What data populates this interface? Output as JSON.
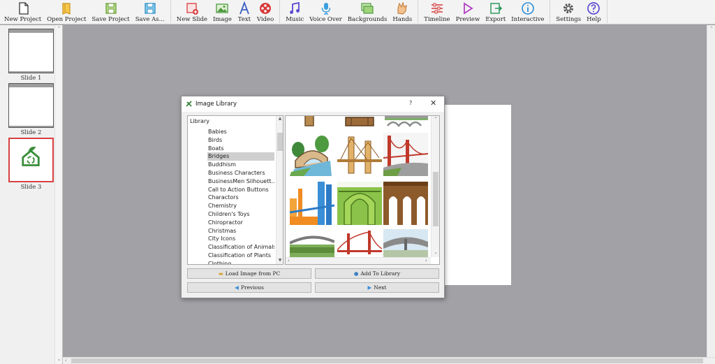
{
  "toolbar": {
    "groups": [
      [
        {
          "id": "new-project",
          "label": "New Project",
          "icon": "new-document-icon"
        },
        {
          "id": "open-project",
          "label": "Open Project",
          "icon": "open-folder-icon"
        },
        {
          "id": "save-project",
          "label": "Save Project",
          "icon": "save-icon"
        },
        {
          "id": "save-as",
          "label": "Save As...",
          "icon": "save-as-icon"
        }
      ],
      [
        {
          "id": "new-slide",
          "label": "New Slide",
          "icon": "new-slide-icon"
        },
        {
          "id": "image",
          "label": "Image",
          "icon": "image-icon"
        },
        {
          "id": "text",
          "label": "Text",
          "icon": "text-icon"
        },
        {
          "id": "video",
          "label": "Video",
          "icon": "video-icon"
        }
      ],
      [
        {
          "id": "music",
          "label": "Music",
          "icon": "music-icon"
        },
        {
          "id": "voice-over",
          "label": "Voice Over",
          "icon": "microphone-icon"
        },
        {
          "id": "backgrounds",
          "label": "Backgrounds",
          "icon": "backgrounds-icon"
        },
        {
          "id": "hands",
          "label": "Hands",
          "icon": "hand-icon"
        }
      ],
      [
        {
          "id": "timeline",
          "label": "Timeline",
          "icon": "timeline-icon"
        },
        {
          "id": "preview",
          "label": "Preview",
          "icon": "play-icon"
        },
        {
          "id": "export",
          "label": "Export",
          "icon": "export-icon"
        },
        {
          "id": "interactive",
          "label": "Interactive",
          "icon": "info-icon"
        }
      ],
      [
        {
          "id": "settings",
          "label": "Settings",
          "icon": "gear-icon"
        },
        {
          "id": "help",
          "label": "Help",
          "icon": "help-icon"
        }
      ]
    ]
  },
  "slides": [
    {
      "label": "Slide 1",
      "active": false
    },
    {
      "label": "Slide 2",
      "active": false
    },
    {
      "label": "Slide 3",
      "active": true
    }
  ],
  "dialog": {
    "title": "Image Library",
    "help": "?",
    "close": "✕",
    "tree_root": "Library",
    "categories": [
      "Babies",
      "Birds",
      "Boats",
      "Bridges",
      "Buddhism",
      "Business Characters",
      "BusinessMen Silhouett...",
      "Call to Action Buttons",
      "Charactors",
      "Chemistry",
      "Children's Toys",
      "Chiropractor",
      "Christmas",
      "City Icons",
      "Classification of Animals",
      "Classification of Plants",
      "Clothing"
    ],
    "selected_category": "Bridges",
    "buttons": {
      "load": "Load Image from PC",
      "add": "Add To Library",
      "previous": "Previous",
      "next": "Next"
    }
  },
  "colors": {
    "accent_red": "#e53935",
    "toolbar_bg": "#f3f3f3",
    "canvas_bg": "#a2a1a6"
  }
}
